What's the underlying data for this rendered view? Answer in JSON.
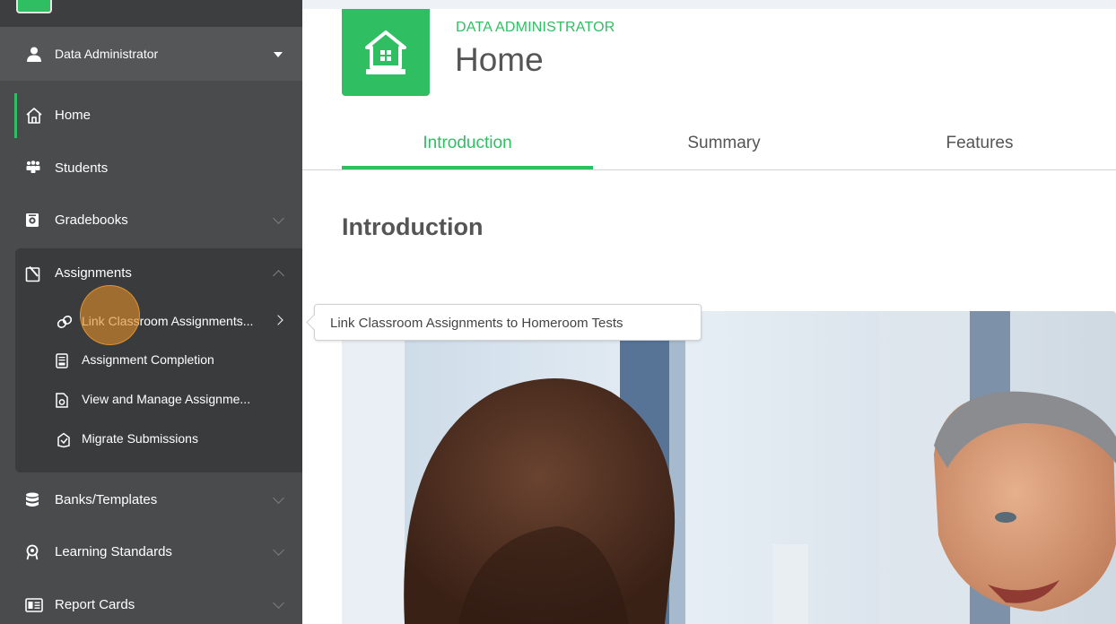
{
  "sidebar": {
    "user": {
      "label": "Data Administrator",
      "icon": "user-icon"
    },
    "items": [
      {
        "label": "Home",
        "icon": "home-outline-icon"
      },
      {
        "label": "Students",
        "icon": "students-icon"
      },
      {
        "label": "Gradebooks",
        "icon": "gradebook-icon"
      },
      {
        "label": "Assignments",
        "icon": "assignment-icon"
      },
      {
        "label": "Banks/Templates",
        "icon": "database-icon"
      },
      {
        "label": "Learning Standards",
        "icon": "standards-icon"
      },
      {
        "label": "Report Cards",
        "icon": "report-card-icon"
      }
    ],
    "assignments_sub": [
      {
        "label": "Link Classroom Assignments...",
        "icon": "link-icon"
      },
      {
        "label": "Assignment Completion",
        "icon": "document-icon"
      },
      {
        "label": "View and Manage Assignme...",
        "icon": "manage-document-icon"
      },
      {
        "label": "Migrate Submissions",
        "icon": "migrate-icon"
      }
    ]
  },
  "header": {
    "role": "DATA ADMINISTRATOR",
    "title": "Home"
  },
  "tabs": [
    {
      "label": "Introduction",
      "active": true
    },
    {
      "label": "Summary",
      "active": false
    },
    {
      "label": "Features",
      "active": false
    }
  ],
  "section": {
    "heading": "Introduction"
  },
  "tooltip": {
    "text": "Link Classroom Assignments to Homeroom Tests"
  },
  "colors": {
    "accent": "#2fbf62",
    "sidebar_bg": "#4a4b4d",
    "highlight": "#de8c28"
  }
}
